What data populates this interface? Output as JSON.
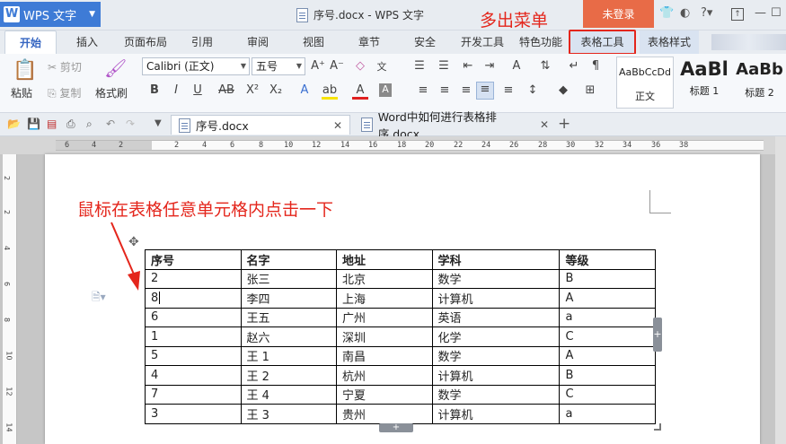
{
  "app": {
    "name": "WPS 文字",
    "window_title": "序号.docx - WPS 文字",
    "login_label": "未登录",
    "annotation_menu": "多出菜单"
  },
  "tabs": [
    "开始",
    "插入",
    "页面布局",
    "引用",
    "审阅",
    "视图",
    "章节",
    "安全",
    "开发工具",
    "特色功能",
    "表格工具",
    "表格样式"
  ],
  "ribbon": {
    "paste": "粘贴",
    "cut": "剪切",
    "copy": "复制",
    "format_painter": "格式刷",
    "font_name": "Calibri (正文)",
    "font_size": "五号",
    "styles": [
      {
        "preview": "AaBbCcDd",
        "name": "正文"
      },
      {
        "preview": "AaBl",
        "name": "标题 1"
      },
      {
        "preview": "AaBb",
        "name": "标题 2"
      }
    ]
  },
  "doc_tabs": [
    {
      "label": "序号.docx"
    },
    {
      "label": "Word中如何进行表格排序.docx"
    }
  ],
  "ruler": {
    "h": [
      "6",
      "4",
      "2",
      "2",
      "4",
      "6",
      "8",
      "10",
      "12",
      "14",
      "16",
      "18",
      "20",
      "22",
      "24",
      "26",
      "28",
      "30",
      "32",
      "34",
      "36",
      "38"
    ],
    "v": [
      "2",
      "2",
      "4",
      "6",
      "8",
      "10",
      "12",
      "14"
    ]
  },
  "document": {
    "annotation": "鼠标在表格任意单元格内点击一下",
    "table": {
      "headers": [
        "序号",
        "名字",
        "地址",
        "学科",
        "等级"
      ],
      "rows": [
        [
          "2",
          "张三",
          "北京",
          "数学",
          "B"
        ],
        [
          "8",
          "李四",
          "上海",
          "计算机",
          "A"
        ],
        [
          "6",
          "王五",
          "广州",
          "英语",
          "a"
        ],
        [
          "1",
          "赵六",
          "深圳",
          "化学",
          "C"
        ],
        [
          "5",
          "王 1",
          "南昌",
          "数学",
          "A"
        ],
        [
          "4",
          "王 2",
          "杭州",
          "计算机",
          "B"
        ],
        [
          "7",
          "王 4",
          "宁夏",
          "数学",
          "C"
        ],
        [
          "3",
          "王 3",
          "贵州",
          "计算机",
          "a"
        ]
      ]
    }
  },
  "colors": {
    "accent": "#3e7bd6",
    "annotation": "#e4261c",
    "login_bg": "#e86b47"
  }
}
